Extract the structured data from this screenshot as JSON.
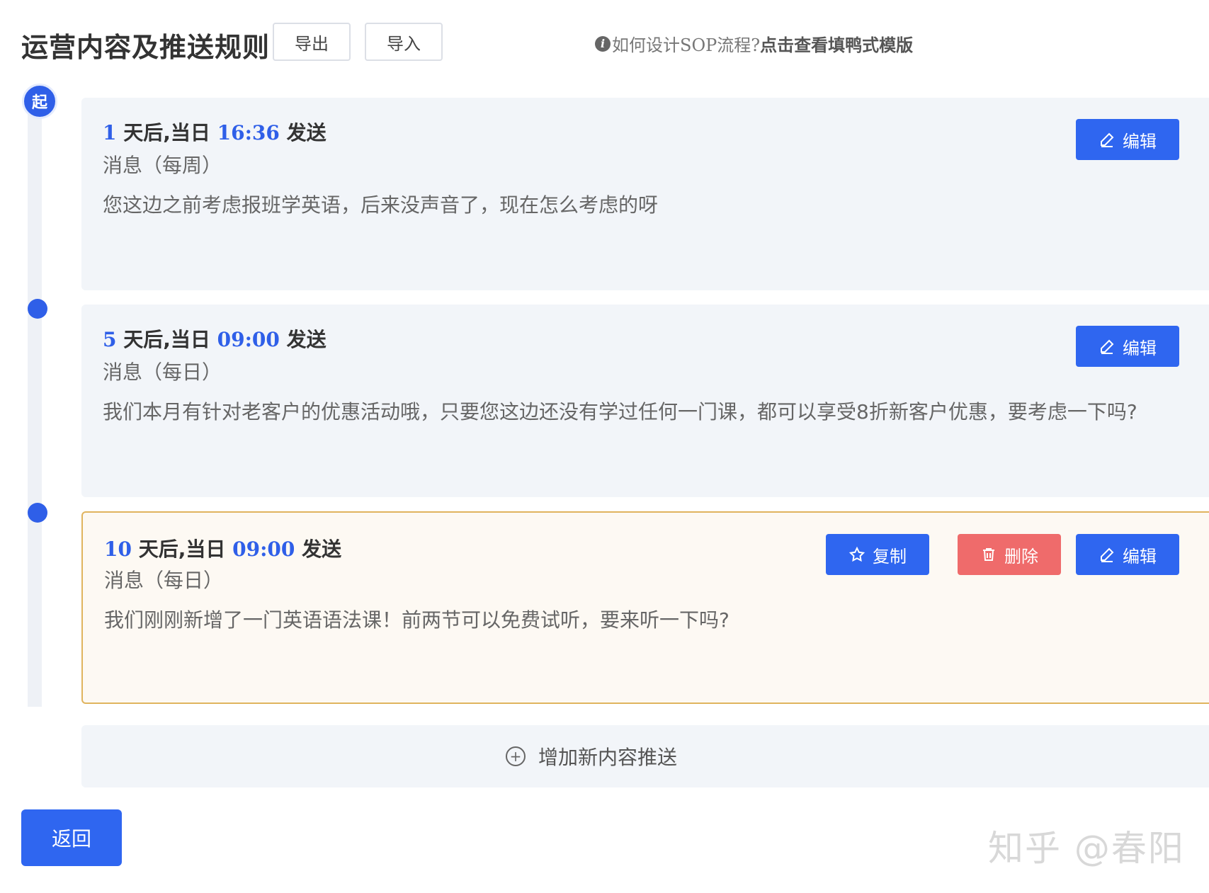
{
  "header": {
    "title": "运营内容及推送规则",
    "export_label": "导出",
    "import_label": "导入",
    "help_prefix": "如何设计SOP流程?",
    "help_link": "点击查看填鸭式模版"
  },
  "timeline": {
    "start_label": "起"
  },
  "cards": [
    {
      "days": "1",
      "mid_text": " 天后,当日 ",
      "time": "16:36",
      "send": " 发送",
      "type": "消息（每周）",
      "content": "您这边之前考虑报班学英语，后来没声音了，现在怎么考虑的呀",
      "edit_label": "编辑"
    },
    {
      "days": "5",
      "mid_text": " 天后,当日 ",
      "time": "09:00",
      "send": " 发送",
      "type": "消息（每日）",
      "content": "我们本月有针对老客户的优惠活动哦，只要您这边还没有学过任何一门课，都可以享受8折新客户优惠，要考虑一下吗?",
      "edit_label": "编辑"
    },
    {
      "days": "10",
      "mid_text": " 天后,当日 ",
      "time": "09:00",
      "send": " 发送",
      "type": "消息（每日）",
      "content": "我们刚刚新增了一门英语语法课！前两节可以免费试听，要来听一下吗?",
      "copy_label": "复制",
      "delete_label": "删除",
      "edit_label": "编辑"
    }
  ],
  "add_bar": {
    "label": "增加新内容推送"
  },
  "footer": {
    "back_label": "返回",
    "watermark": "知乎 @春阳"
  },
  "colors": {
    "primary": "#2f66f0",
    "danger": "#ef6b6b",
    "active_border": "#e0b45e",
    "card_bg": "#f2f5f9"
  }
}
